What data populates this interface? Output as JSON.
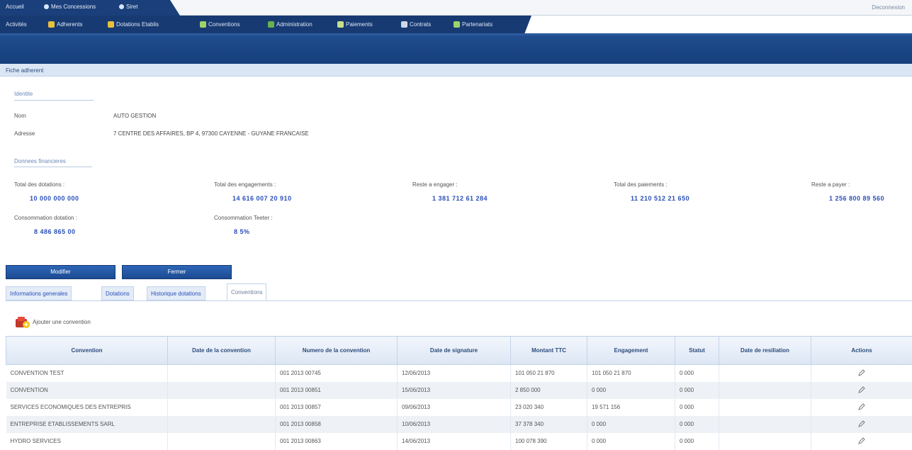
{
  "top_tabs": [
    "Accueil",
    "Mes Concessions",
    "Siret"
  ],
  "user_area": "Deconnexion",
  "menu": [
    {
      "label": "Activités"
    },
    {
      "label": "Adherents",
      "icon_color": "#e8c13a"
    },
    {
      "label": "Dotations Etablis",
      "icon_color": "#e8c13a"
    },
    {
      "label": "Conventions",
      "icon_color": "#9ed36a"
    },
    {
      "label": "Administration",
      "icon_color": "#6ab04c"
    },
    {
      "label": "Paiements",
      "icon_color": "#c7e08a"
    },
    {
      "label": "Contrats",
      "icon_color": "#cfd8e6"
    },
    {
      "label": "Partenariats",
      "icon_color": "#9ed36a"
    }
  ],
  "breadcrumb": "Fiche adherent",
  "identity": {
    "section_title": "Identite",
    "name_label": "Nom",
    "name_value": "AUTO GESTION",
    "address_label": "Adresse",
    "address_value": "7 CENTRE DES AFFAIRES, BP 4, 97300 CAYENNE - GUYANE FRANCAISE"
  },
  "financial": {
    "section_title": "Donnees financieres",
    "items": [
      {
        "label": "Total des dotations :",
        "value": "10 000 000 000"
      },
      {
        "label": "Total des engagements :",
        "value": "14 616 007 20 910"
      },
      {
        "label": "Reste a engager :",
        "value": "1 381 712 61 284"
      },
      {
        "label": "Total des paiements :",
        "value": "11 210 512 21 650"
      },
      {
        "label": "Reste a payer :",
        "value": "1 256 800 89 560"
      },
      {
        "label": "Consommation dotation :",
        "value": "8 486 865 00"
      },
      {
        "label": "Consommation Teeter :",
        "value": "8 5%"
      }
    ]
  },
  "buttons": {
    "modifier": "Modifier",
    "fermer": "Fermer"
  },
  "sub_tabs": [
    "Informations generales",
    "Dotations",
    "Historique dotations",
    "Conventions"
  ],
  "add_label": "Ajouter une convention",
  "table": {
    "columns": [
      "Convention",
      "Date de la convention",
      "Numero de la convention",
      "Date de signature",
      "Montant TTC",
      "Engagement",
      "Statut",
      "Date de resiliation",
      "Actions"
    ],
    "rows": [
      [
        "CONVENTION TEST",
        "",
        "001 2013 00745",
        "12/06/2013",
        "101 050 21 870",
        "101 050 21 870",
        "0 000",
        "",
        ""
      ],
      [
        "CONVENTION",
        "",
        "001 2013 00851",
        "15/06/2013",
        "2 850 000",
        "0 000",
        "0 000",
        "",
        ""
      ],
      [
        "SERVICES ECONOMIQUES DES ENTREPRIS",
        "",
        "001 2013 00857",
        "09/06/2013",
        "23 020 340",
        "19 571 156",
        "0 000",
        "",
        ""
      ],
      [
        "ENTREPRISE ETABLISSEMENTS SARL",
        "",
        "001 2013 00858",
        "10/06/2013",
        "37 378 340",
        "0 000",
        "0 000",
        "",
        ""
      ],
      [
        "HYDRO SERVICES",
        "",
        "001 2013 00863",
        "14/06/2013",
        "100 078 390",
        "0 000",
        "0 000",
        "",
        ""
      ]
    ]
  }
}
